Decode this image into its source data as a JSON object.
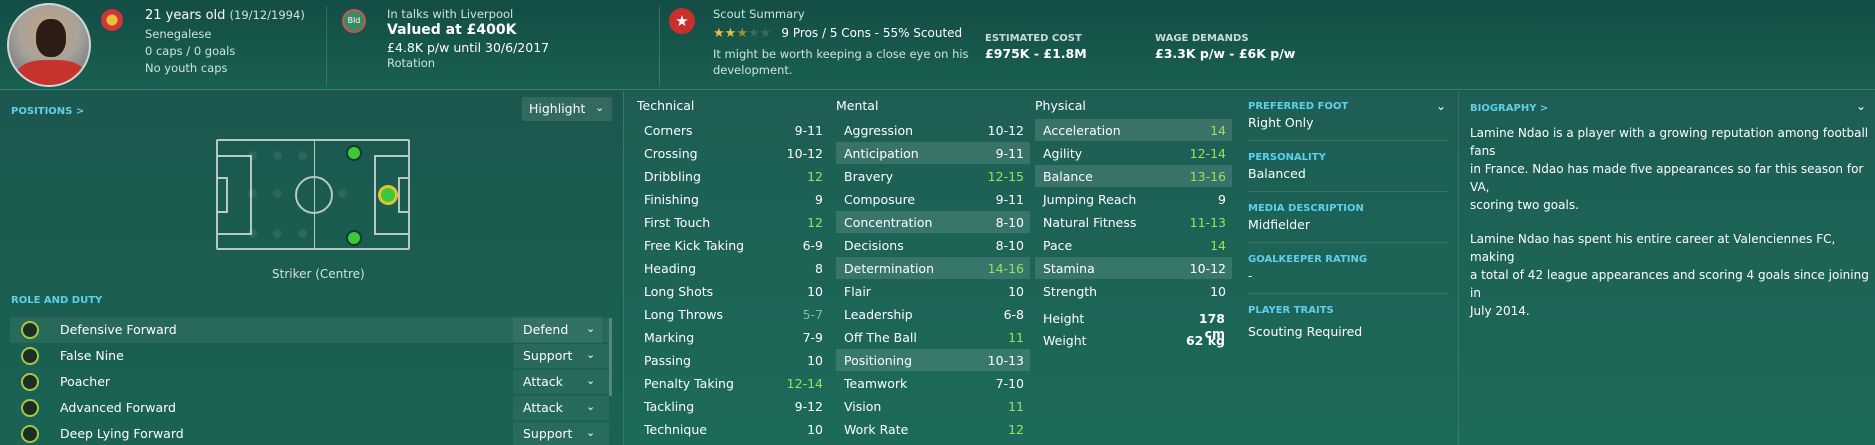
{
  "header": {
    "age": "21 years old",
    "dob": "(19/12/1994)",
    "nationality": "Senegalese",
    "caps": "0 caps / 0 goals",
    "youth_caps": "No youth caps",
    "club_badge_text": "Bld",
    "talks": "In talks with Liverpool",
    "valued": "Valued at £400K",
    "contract": "£4.8K p/w until 30/6/2017",
    "status": "Rotation",
    "scout_title": "Scout Summary",
    "stars": "★★",
    "stars_half": "★",
    "stars_empty": "★★",
    "scout_line": "9 Pros / 5 Cons - 55% Scouted",
    "scout_note_1": "It might be worth keeping a close eye on his",
    "scout_note_2": "development.",
    "est_cost_label": "ESTIMATED COST",
    "est_cost": "£975K - £1.8M",
    "wage_label": "WAGE DEMANDS",
    "wage": "£3.3K p/w - £6K p/w"
  },
  "positions": {
    "label": "POSITIONS >",
    "highlight": "Highlight",
    "position_name": "Striker (Centre)"
  },
  "roles": {
    "label": "ROLE AND DUTY",
    "items": [
      {
        "name": "Defensive Forward",
        "duty": "Defend"
      },
      {
        "name": "False Nine",
        "duty": "Support"
      },
      {
        "name": "Poacher",
        "duty": "Attack"
      },
      {
        "name": "Advanced Forward",
        "duty": "Attack"
      },
      {
        "name": "Deep Lying Forward",
        "duty": "Support"
      }
    ]
  },
  "technical": {
    "title": "Technical",
    "rows": [
      {
        "n": "Corners",
        "v": "9-11"
      },
      {
        "n": "Crossing",
        "v": "10-12"
      },
      {
        "n": "Dribbling",
        "v": "12"
      },
      {
        "n": "Finishing",
        "v": "9"
      },
      {
        "n": "First Touch",
        "v": "12"
      },
      {
        "n": "Free Kick Taking",
        "v": "6-9"
      },
      {
        "n": "Heading",
        "v": "8"
      },
      {
        "n": "Long Shots",
        "v": "10"
      },
      {
        "n": "Long Throws",
        "v": "5-7"
      },
      {
        "n": "Marking",
        "v": "7-9"
      },
      {
        "n": "Passing",
        "v": "10"
      },
      {
        "n": "Penalty Taking",
        "v": "12-14"
      },
      {
        "n": "Tackling",
        "v": "9-12"
      },
      {
        "n": "Technique",
        "v": "10"
      }
    ]
  },
  "mental": {
    "title": "Mental",
    "rows": [
      {
        "n": "Aggression",
        "v": "10-12"
      },
      {
        "n": "Anticipation",
        "v": "9-11"
      },
      {
        "n": "Bravery",
        "v": "12-15"
      },
      {
        "n": "Composure",
        "v": "9-11"
      },
      {
        "n": "Concentration",
        "v": "8-10"
      },
      {
        "n": "Decisions",
        "v": "8-10"
      },
      {
        "n": "Determination",
        "v": "14-16"
      },
      {
        "n": "Flair",
        "v": "10"
      },
      {
        "n": "Leadership",
        "v": "6-8"
      },
      {
        "n": "Off The Ball",
        "v": "11"
      },
      {
        "n": "Positioning",
        "v": "10-13"
      },
      {
        "n": "Teamwork",
        "v": "7-10"
      },
      {
        "n": "Vision",
        "v": "11"
      },
      {
        "n": "Work Rate",
        "v": "12"
      }
    ]
  },
  "physical": {
    "title": "Physical",
    "rows": [
      {
        "n": "Acceleration",
        "v": "14"
      },
      {
        "n": "Agility",
        "v": "12-14"
      },
      {
        "n": "Balance",
        "v": "13-16"
      },
      {
        "n": "Jumping Reach",
        "v": "9"
      },
      {
        "n": "Natural Fitness",
        "v": "11-13"
      },
      {
        "n": "Pace",
        "v": "14"
      },
      {
        "n": "Stamina",
        "v": "10-12"
      },
      {
        "n": "Strength",
        "v": "10"
      }
    ],
    "height_label": "Height",
    "height": "178 cm",
    "weight_label": "Weight",
    "weight": "62 kg"
  },
  "info": {
    "foot_label": "PREFERRED FOOT",
    "foot": "Right Only",
    "personality_label": "PERSONALITY",
    "personality": "Balanced",
    "media_label": "MEDIA DESCRIPTION",
    "media": "Midfielder",
    "gk_label": "GOALKEEPER RATING",
    "gk": "-",
    "traits_label": "PLAYER TRAITS",
    "traits": "Scouting Required"
  },
  "bio": {
    "label": "BIOGRAPHY >",
    "p1a": "Lamine Ndao is a player with a growing reputation among football fans",
    "p1b": "in France. Ndao has made five appearances so far this season for VA,",
    "p1c": "scoring two goals.",
    "p2a": "Lamine Ndao has spent his entire career at Valenciennes FC, making",
    "p2b": "a total of 42 league appearances and scoring 4 goals since joining in",
    "p2c": "July 2014."
  },
  "colors": {
    "green_value": "#9ee158",
    "dim_value": "#8fb3a9",
    "accent_blue": "#5fd0ea"
  }
}
